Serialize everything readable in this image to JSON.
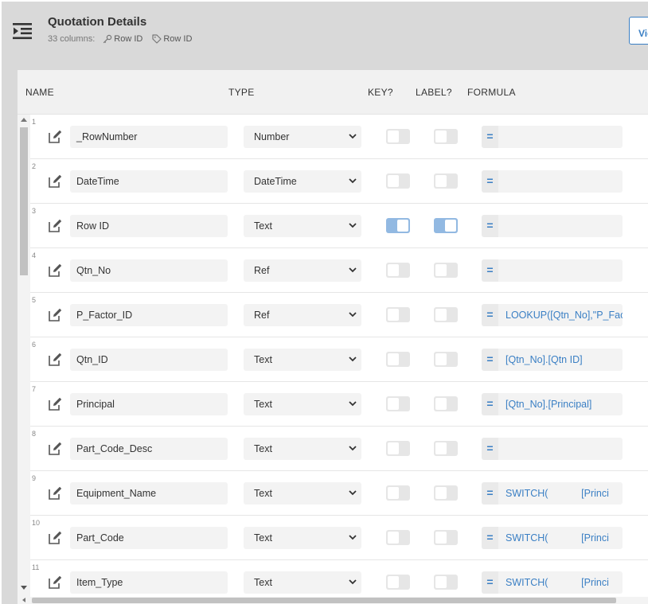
{
  "header": {
    "title": "Quotation Details",
    "column_count": "33",
    "columns_label": "columns:",
    "key_tag": "Row ID",
    "label_tag": "Row ID",
    "view_button_label": "View"
  },
  "table": {
    "headers": {
      "name": "NAME",
      "type": "TYPE",
      "key": "KEY?",
      "label": "LABEL?",
      "formula": "FORMULA"
    },
    "rows": [
      {
        "num": "1",
        "name": "_RowNumber",
        "type": "Number",
        "key": false,
        "label": false,
        "formula": ""
      },
      {
        "num": "2",
        "name": "DateTime",
        "type": "DateTime",
        "key": false,
        "label": false,
        "formula": ""
      },
      {
        "num": "3",
        "name": "Row ID",
        "type": "Text",
        "key": true,
        "label": true,
        "formula": ""
      },
      {
        "num": "4",
        "name": "Qtn_No",
        "type": "Ref",
        "key": false,
        "label": false,
        "formula": ""
      },
      {
        "num": "5",
        "name": "P_Factor_ID",
        "type": "Ref",
        "key": false,
        "label": false,
        "formula": "LOOKUP([Qtn_No],\"P_Fac"
      },
      {
        "num": "6",
        "name": "Qtn_ID",
        "type": "Text",
        "key": false,
        "label": false,
        "formula": "[Qtn_No].[Qtn ID]"
      },
      {
        "num": "7",
        "name": "Principal",
        "type": "Text",
        "key": false,
        "label": false,
        "formula": "[Qtn_No].[Principal]"
      },
      {
        "num": "8",
        "name": "Part_Code_Desc",
        "type": "Text",
        "key": false,
        "label": false,
        "formula": ""
      },
      {
        "num": "9",
        "name": "Equipment_Name",
        "type": "Text",
        "key": false,
        "label": false,
        "formula": "SWITCH(            [Princi"
      },
      {
        "num": "10",
        "name": "Part_Code",
        "type": "Text",
        "key": false,
        "label": false,
        "formula": "SWITCH(            [Princi"
      },
      {
        "num": "11",
        "name": "Item_Type",
        "type": "Text",
        "key": false,
        "label": false,
        "formula": "SWITCH(            [Princi"
      }
    ],
    "formula_prefix": "="
  },
  "colors": {
    "accent": "#3a7fc4",
    "toggle_on": "#92b9e2",
    "toggle_off": "#e6e6e6",
    "header_bg": "#d9d9d9"
  },
  "icons": {
    "collapse": "indent-collapse-icon",
    "edit": "edit-pencil-icon",
    "key_tag": "key-icon",
    "label_tag": "tag-icon",
    "type_dropdown": "chevron-down-icon"
  }
}
